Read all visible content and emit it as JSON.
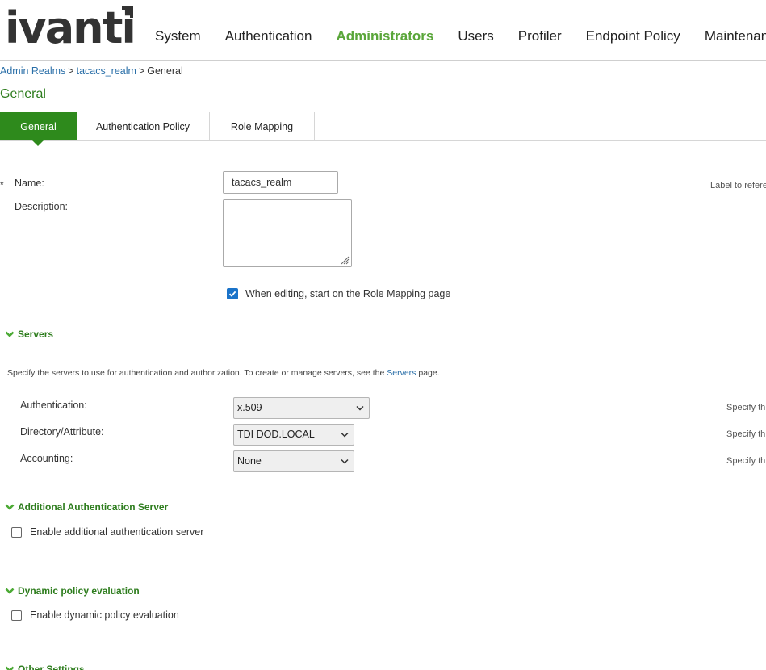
{
  "header": {
    "logo_text": "ivanti",
    "nav": [
      {
        "label": "System",
        "active": false
      },
      {
        "label": "Authentication",
        "active": false
      },
      {
        "label": "Administrators",
        "active": true
      },
      {
        "label": "Users",
        "active": false
      },
      {
        "label": "Profiler",
        "active": false
      },
      {
        "label": "Endpoint Policy",
        "active": false
      },
      {
        "label": "Maintenance",
        "active": false
      }
    ]
  },
  "breadcrumb": {
    "items": [
      "Admin Realms",
      "tacacs_realm"
    ],
    "separator": ">",
    "current": "General"
  },
  "page_title": "General",
  "tabs": [
    {
      "label": "General",
      "active": true
    },
    {
      "label": "Authentication Policy",
      "active": false
    },
    {
      "label": "Role Mapping",
      "active": false
    }
  ],
  "form": {
    "required_marker": "*",
    "name_label": "Name:",
    "name_value": "tacacs_realm",
    "name_hint": "Label to refere",
    "description_label": "Description:",
    "description_value": "",
    "role_mapping_checkbox_label": "When editing, start on the Role Mapping page",
    "role_mapping_checked": true
  },
  "servers": {
    "title": "Servers",
    "info_prefix": "Specify the servers to use for authentication and authorization. To create or manage servers, see the ",
    "info_link": "Servers",
    "info_suffix": " page.",
    "rows": [
      {
        "label": "Authentication:",
        "value": "x.509",
        "hint": "Specify th"
      },
      {
        "label": "Directory/Attribute:",
        "value": "TDI DOD.LOCAL",
        "hint": "Specify th"
      },
      {
        "label": "Accounting:",
        "value": "None",
        "hint": "Specify th"
      }
    ]
  },
  "additional_auth": {
    "title": "Additional Authentication Server",
    "checkbox_label": "Enable additional authentication server",
    "checked": false
  },
  "dynamic_policy": {
    "title": "Dynamic policy evaluation",
    "checkbox_label": "Enable dynamic policy evaluation",
    "checked": false
  },
  "other_settings": {
    "title": "Other Settings"
  },
  "colors": {
    "brand_green": "#2e8a1c",
    "nav_active": "#5aa63a",
    "link_blue": "#2a6fa8",
    "checkbox_blue": "#1a73c9"
  }
}
